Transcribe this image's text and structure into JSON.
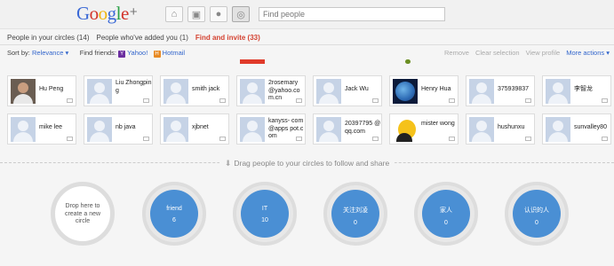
{
  "header": {
    "logo_text": "Google",
    "logo_plus": "+",
    "search_placeholder": "Find people"
  },
  "nav_buttons": [
    "home-icon",
    "photos-icon",
    "profile-icon",
    "circles-icon"
  ],
  "tabs": [
    {
      "label": "People in your circles (14)",
      "active": false
    },
    {
      "label": "People who've added you (1)",
      "active": false
    },
    {
      "label": "Find and invite (33)",
      "active": true
    }
  ],
  "filter": {
    "sort_label": "Sort by:",
    "sort_value": "Relevance ▾",
    "find_friends_label": "Find friends:",
    "yahoo": "Yahoo!",
    "hotmail": "Hotmail",
    "actions": [
      "Remove",
      "Clear selection",
      "View profile",
      "More actions ▾"
    ]
  },
  "people": [
    {
      "name": "Hu Peng",
      "avatar": "photo"
    },
    {
      "name": "Liu Zhongping",
      "avatar": "default"
    },
    {
      "name": "smith jack",
      "avatar": "default"
    },
    {
      "name": "2rosemary @yahoo.co m.cn",
      "avatar": "default"
    },
    {
      "name": "Jack Wu",
      "avatar": "default"
    },
    {
      "name": "Henry Hua",
      "avatar": "earth"
    },
    {
      "name": "375939837",
      "avatar": "default"
    },
    {
      "name": "李智龙",
      "avatar": "default"
    },
    {
      "name": "mike lee",
      "avatar": "default"
    },
    {
      "name": "nb java",
      "avatar": "default"
    },
    {
      "name": "xjbnet",
      "avatar": "default"
    },
    {
      "name": "kanyss- com@apps pot.com",
      "avatar": "default"
    },
    {
      "name": "20397795 @qq.com",
      "avatar": "default"
    },
    {
      "name": "mister wong",
      "avatar": "yellow"
    },
    {
      "name": "hushunxu",
      "avatar": "default"
    },
    {
      "name": "sunvalley80",
      "avatar": "default"
    }
  ],
  "drag": {
    "text": "Drag people to your circles to follow and share"
  },
  "drop_zone": {
    "text": "Drop here to create a new circle"
  },
  "circles": [
    {
      "name": "friend",
      "count": "6"
    },
    {
      "name": "IT",
      "count": "10"
    },
    {
      "name": "关注刘凌",
      "count": "0"
    },
    {
      "name": "家人",
      "count": "0"
    },
    {
      "name": "认识的人",
      "count": "0"
    }
  ],
  "colors": {
    "circle_blue": "#4a8fd4",
    "active_tab": "#d44332",
    "link": "#3366cc"
  }
}
